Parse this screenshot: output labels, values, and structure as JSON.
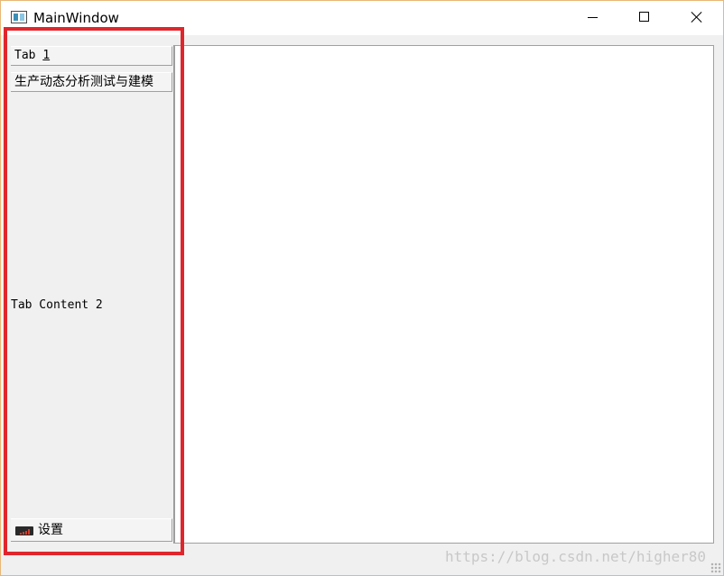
{
  "window": {
    "title": "MainWindow"
  },
  "icons": {
    "app": "window-app-icon",
    "minimize": "minimize-icon",
    "maximize": "maximize-icon",
    "close": "close-icon",
    "settings": "signal-bars-icon"
  },
  "sidebar": {
    "tabs": [
      {
        "label_prefix": "Tab ",
        "label_mnemonic": "1"
      },
      {
        "label": "生产动态分析测试与建模"
      }
    ],
    "content_text": "Tab Content 2",
    "settings_label": "设置"
  },
  "watermark": "https://blog.csdn.net/higher80",
  "colors": {
    "highlight": "#e0262c",
    "panel_bg": "#f0f0f0",
    "main_bg": "#ffffff"
  }
}
